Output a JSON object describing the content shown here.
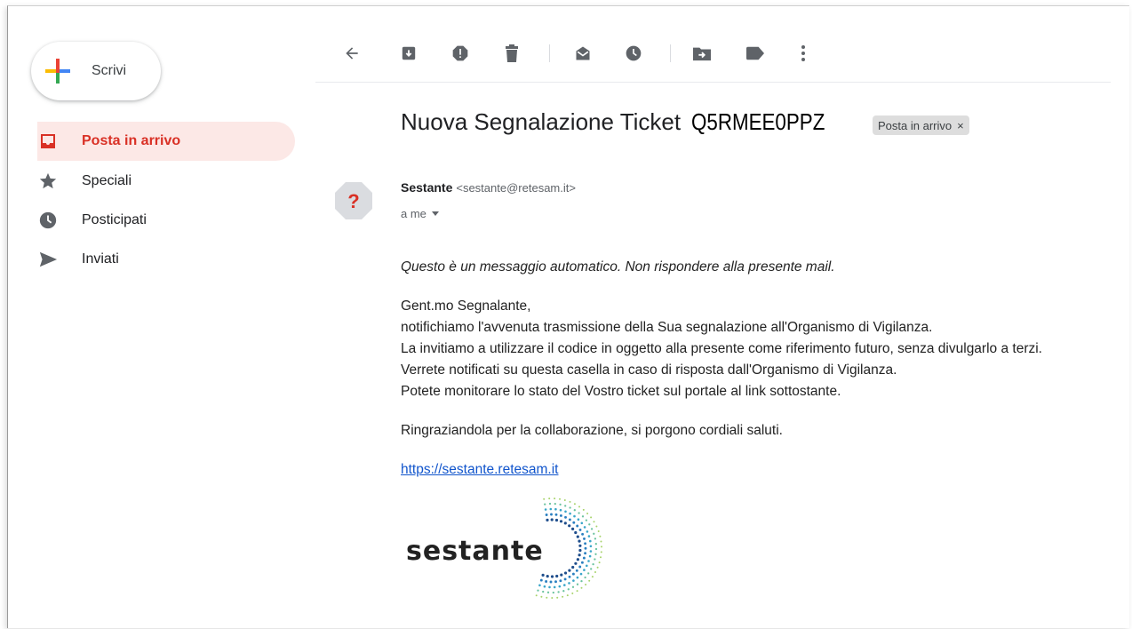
{
  "sidebar": {
    "compose_label": "Scrivi",
    "items": [
      {
        "label": "Posta in arrivo",
        "icon": "inbox-icon",
        "active": true
      },
      {
        "label": "Speciali",
        "icon": "star-icon"
      },
      {
        "label": "Posticipati",
        "icon": "clock-icon"
      },
      {
        "label": "Inviati",
        "icon": "send-icon"
      }
    ]
  },
  "toolbar": {
    "icons": [
      "back-arrow-icon",
      "archive-icon",
      "report-spam-icon",
      "delete-icon",
      "mark-unread-icon",
      "snooze-icon",
      "move-to-icon",
      "label-icon",
      "more-vert-icon"
    ]
  },
  "email": {
    "subject_text": "Nuova Segnalazione Ticket",
    "ticket_code": "Q5RMEE0PPZ",
    "label_chip": "Posta in arrivo",
    "label_chip_close": "×",
    "sender_name": "Sestante",
    "sender_email": "<sestante@retesam.it>",
    "recipient": "a me",
    "auto_notice": "Questo è un messaggio automatico. Non rispondere alla presente mail.",
    "greeting": "Gent.mo Segnalante,",
    "lines": [
      "notifichiamo l'avvenuta trasmissione della Sua segnalazione all'Organismo di Vigilanza.",
      "La invitiamo a utilizzare il codice in oggetto alla presente come riferimento futuro, senza divulgarlo a terzi.",
      "Verrete notificati su questa casella in caso di risposta dall'Organismo di Vigilanza.",
      "Potete monitorare lo stato del Vostro ticket sul portale al link sottostante."
    ],
    "closing": "Ringraziandola per la collaborazione, si porgono cordiali saluti.",
    "link": "https://sestante.retesam.it",
    "logo_text": "sestante"
  },
  "colors": {
    "active_red": "#d93025",
    "active_bg": "#fce8e6",
    "icon_gray": "#5f6368",
    "link_blue": "#1155cc"
  }
}
